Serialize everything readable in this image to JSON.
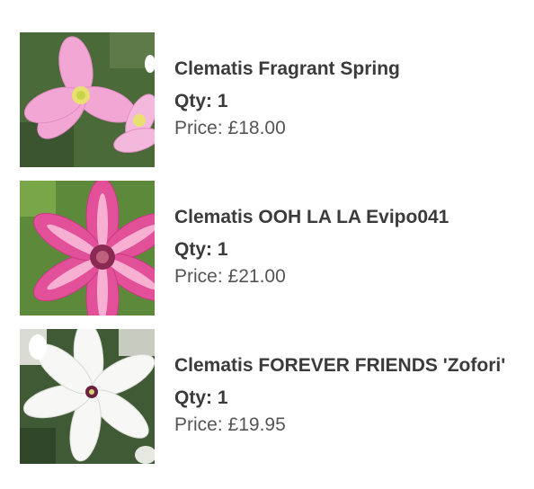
{
  "cart": {
    "items": [
      {
        "name": "Clematis Fragrant Spring",
        "qty_label": "Qty:",
        "qty": "1",
        "price_label": "Price:",
        "price": "£18.00",
        "image": "clematis-fragrant-spring-photo"
      },
      {
        "name": "Clematis OOH LA LA Evipo041",
        "qty_label": "Qty:",
        "qty": "1",
        "price_label": "Price:",
        "price": "£21.00",
        "image": "clematis-ooh-la-la-photo"
      },
      {
        "name": "Clematis FOREVER FRIENDS 'Zofori'",
        "qty_label": "Qty:",
        "qty": "1",
        "price_label": "Price:",
        "price": "£19.95",
        "image": "clematis-forever-friends-photo"
      }
    ]
  }
}
